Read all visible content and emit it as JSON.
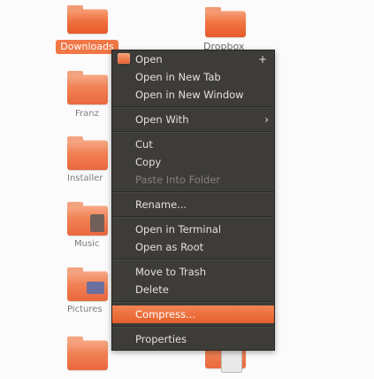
{
  "desktop": {
    "items": [
      {
        "label": "Downloads"
      },
      {
        "label": "Dropbox"
      },
      {
        "label": "Franz"
      },
      {
        "label": "Installer"
      },
      {
        "label": "Music"
      },
      {
        "label": "Pictures"
      }
    ]
  },
  "menu": {
    "open": "Open",
    "open_new_tab": "Open in New Tab",
    "open_new_window": "Open in New Window",
    "open_with": "Open With",
    "cut": "Cut",
    "copy": "Copy",
    "paste_into_folder": "Paste Into Folder",
    "rename": "Rename...",
    "open_terminal": "Open in Terminal",
    "open_as_root": "Open as Root",
    "move_to_trash": "Move to Trash",
    "delete": "Delete",
    "compress": "Compress...",
    "properties": "Properties"
  },
  "icons": {
    "plus": "+",
    "chevron": "›"
  },
  "colors": {
    "accent": "#f07746",
    "menu_bg": "#3d3c38"
  }
}
